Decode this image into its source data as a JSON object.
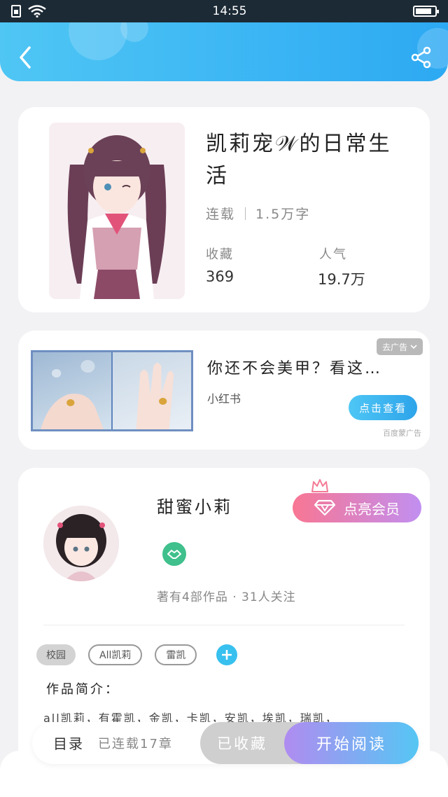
{
  "status_bar": {
    "time": "14:55"
  },
  "book": {
    "title": "凯莉宠𝒲的日常生活",
    "status": "连载",
    "word_count": "1.5万字",
    "favorites_label": "收藏",
    "favorites_value": "369",
    "popularity_label": "人气",
    "popularity_value": "19.7万"
  },
  "ad": {
    "title": "你还不会美甲？看这…",
    "source": "小红书",
    "close_label": "去广告",
    "cta_label": "点击查看",
    "powered_by": "百度蒙广告"
  },
  "author": {
    "name": "甜蜜小莉",
    "stats": "著有4部作品 · 31人关注",
    "vip_label": "点亮会员",
    "tags": [
      "校园",
      "All凯莉",
      "雷凯"
    ],
    "intro_title": "作品简介：",
    "intro_text": "all凯莉，有霍凯，金凯，卡凯，安凯，埃凯，瑞凯，"
  },
  "actions": {
    "toc_label": "目录",
    "toc_progress": "已连载17章",
    "collected_label": "已收藏",
    "read_label": "开始阅读"
  },
  "colors": {
    "header_start": "#4fc6f4",
    "header_end": "#2da9f3",
    "vip_start": "#f87693",
    "vip_end": "#c18ff1",
    "read_start": "#b08cf0",
    "read_end": "#55c6f4"
  }
}
